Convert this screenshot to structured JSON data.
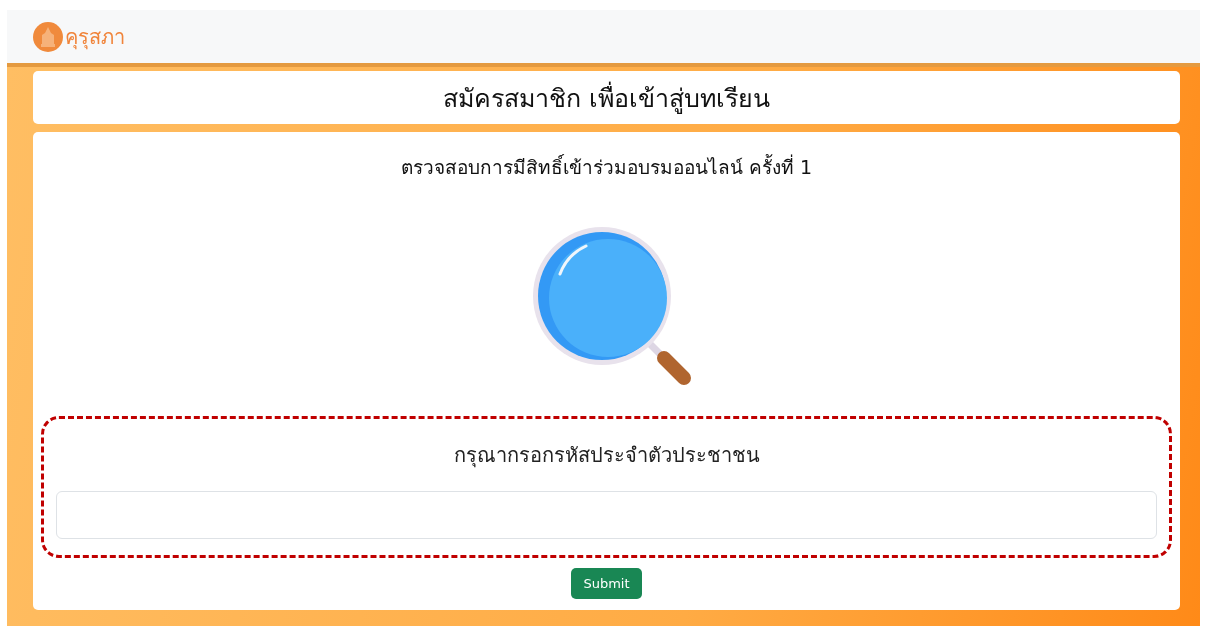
{
  "navbar": {
    "brand": "คุรุสภา"
  },
  "header": {
    "title": "สมัครสมาชิก เพื่อเข้าสู่บทเรียน"
  },
  "check": {
    "title": "ตรวจสอบการมีสิทธิ์เข้าร่วมอบรมออนไลน์ ครั้งที่ 1",
    "prompt": "กรุณากรอกรหัสประจำตัวประชาชน",
    "submit": "Submit"
  }
}
